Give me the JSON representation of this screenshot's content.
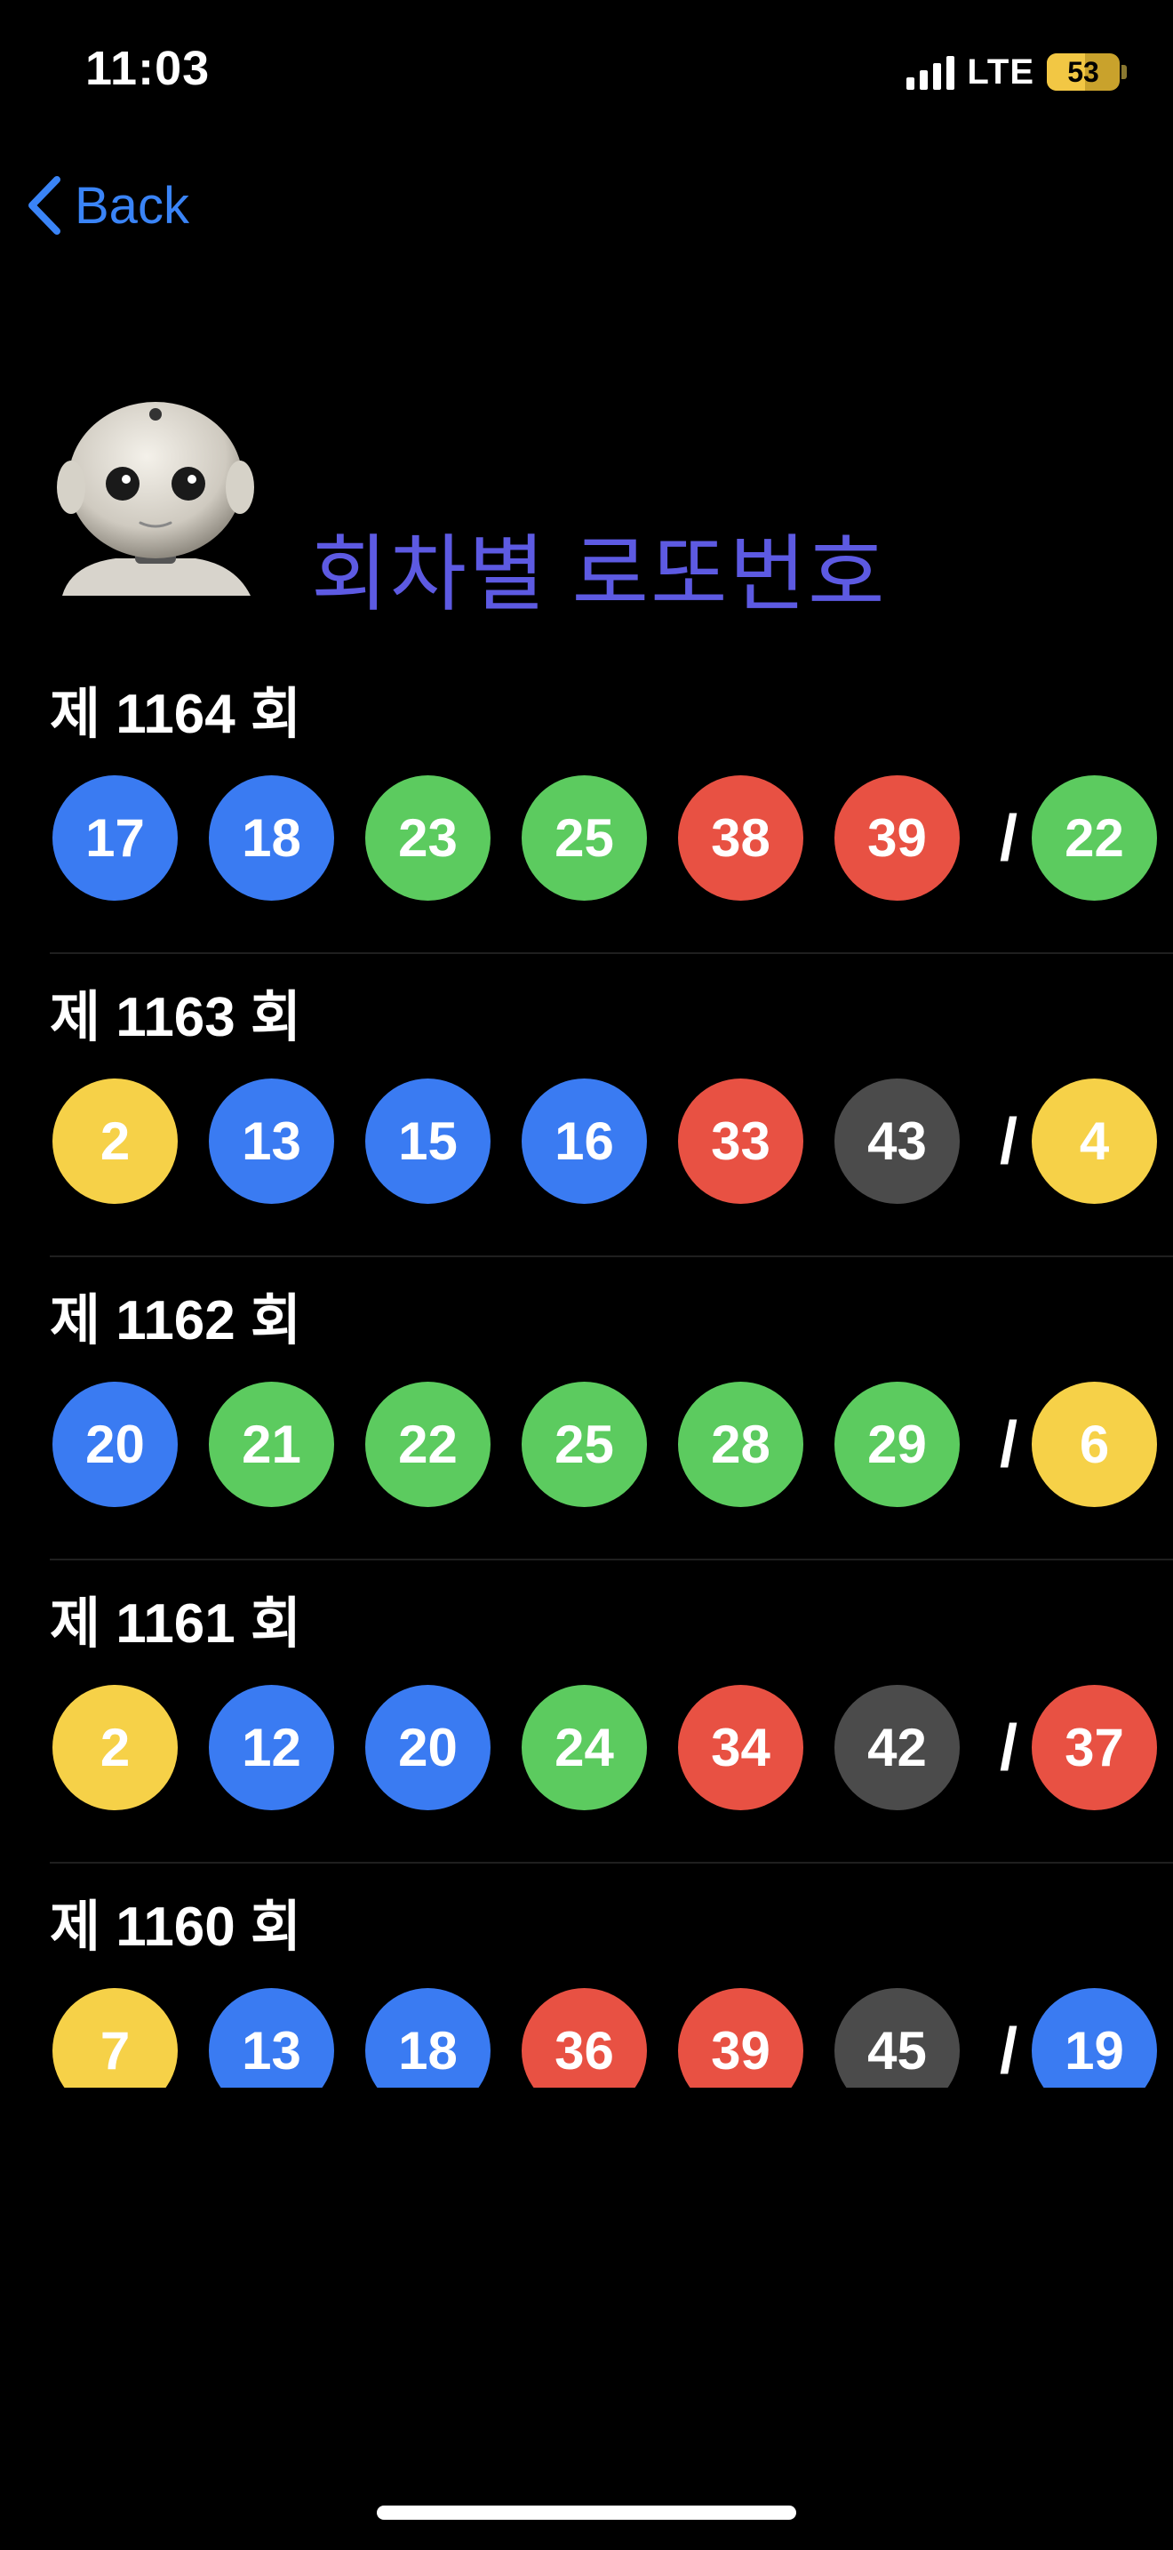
{
  "status_bar": {
    "time": "11:03",
    "network": "LTE",
    "battery": "53"
  },
  "nav": {
    "back_label": "Back"
  },
  "header": {
    "title": "회차별 로또번호"
  },
  "colors": {
    "yellow": "#f6d148",
    "blue": "#3a7bf2",
    "green": "#5ccb5f",
    "red": "#e85143",
    "gray": "#4b4b4b",
    "accent": "#5d5ae2",
    "link": "#3a84f7"
  },
  "draws": [
    {
      "title": "제 1164 회",
      "numbers": [
        "17",
        "18",
        "23",
        "25",
        "38",
        "39"
      ],
      "bonus": "22"
    },
    {
      "title": "제 1163 회",
      "numbers": [
        "2",
        "13",
        "15",
        "16",
        "33",
        "43"
      ],
      "bonus": "4"
    },
    {
      "title": "제 1162 회",
      "numbers": [
        "20",
        "21",
        "22",
        "25",
        "28",
        "29"
      ],
      "bonus": "6"
    },
    {
      "title": "제 1161 회",
      "numbers": [
        "2",
        "12",
        "20",
        "24",
        "34",
        "42"
      ],
      "bonus": "37"
    },
    {
      "title": "제 1160 회",
      "numbers": [
        "7",
        "13",
        "18",
        "36",
        "39",
        "45"
      ],
      "bonus": "19"
    }
  ],
  "separator": "/"
}
